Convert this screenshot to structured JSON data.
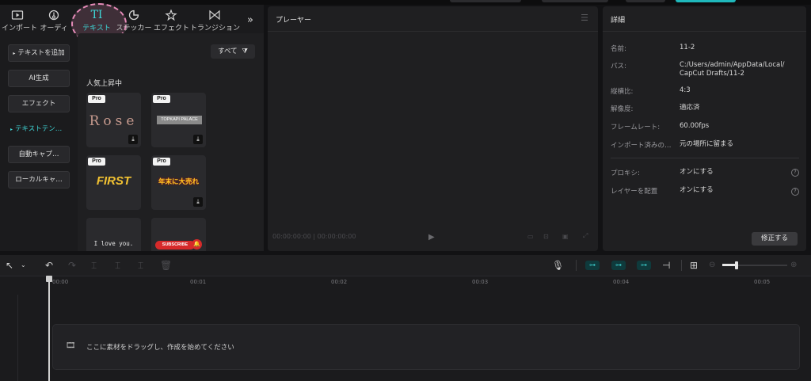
{
  "toolbar_tabs": [
    {
      "label": "インポート",
      "icon": "import-icon"
    },
    {
      "label": "オーディ",
      "icon": "audio-icon"
    },
    {
      "label": "テキスト",
      "icon": "text-icon",
      "glyph": "TI",
      "active": true
    },
    {
      "label": "ステッカー",
      "icon": "sticker-icon"
    },
    {
      "label": "エフェクト",
      "icon": "effect-icon"
    },
    {
      "label": "トランジション",
      "icon": "transition-icon"
    }
  ],
  "more_tabs_glyph": "»",
  "side_nav": [
    {
      "label": "テキストを追加",
      "prefix": "▸"
    },
    {
      "label": "AI生成"
    },
    {
      "label": "エフェクト"
    },
    {
      "label": "テキストテン…",
      "prefix": "▸",
      "active": true
    },
    {
      "label": "自動キャプ…"
    },
    {
      "label": "ローカルキャ…"
    }
  ],
  "filter": {
    "label": "すべて"
  },
  "section_title": "人気上昇中",
  "cards": [
    {
      "pro": "Pro",
      "text": "Rose",
      "download": true
    },
    {
      "pro": "Pro",
      "text": "TOPKAPI PALACE",
      "download": true
    },
    {
      "pro": "Pro",
      "text": "FIRST",
      "download": false
    },
    {
      "pro": "Pro",
      "text": "年末に大売れ",
      "download": true
    },
    {
      "pro": "",
      "text": "I love you.",
      "download": false
    },
    {
      "pro": "",
      "text": "SUBSCRIBE",
      "download": false
    }
  ],
  "player": {
    "title": "プレーヤー",
    "time_current": "00:00:00:00",
    "time_total": "00:00:00:00"
  },
  "details": {
    "title": "詳細",
    "rows": [
      {
        "label": "名前:",
        "value": "11-2"
      },
      {
        "label": "パス:",
        "value": "C:/Users/admin/AppData/Local/ CapCut Drafts/11-2"
      },
      {
        "label": "縦横比:",
        "value": "4:3"
      },
      {
        "label": "解像度:",
        "value": "適応済"
      },
      {
        "label": "フレームレート:",
        "value": "60.00fps"
      },
      {
        "label": "インポート済みの…",
        "value": "元の場所に留まる"
      }
    ],
    "settings": [
      {
        "label": "プロキシ:",
        "value": "オンにする"
      },
      {
        "label": "レイヤーを配置",
        "value": "オンにする"
      }
    ],
    "fix_button": "修正する"
  },
  "timeline": {
    "ticks": [
      "00:00",
      "00:01",
      "00:02",
      "00:03",
      "00:04",
      "00:05"
    ],
    "drop_text": "ここに素材をドラッグし、作成を始めてください"
  },
  "colors": {
    "accent": "#3fd6d6",
    "highlight": "#e58bb8"
  }
}
